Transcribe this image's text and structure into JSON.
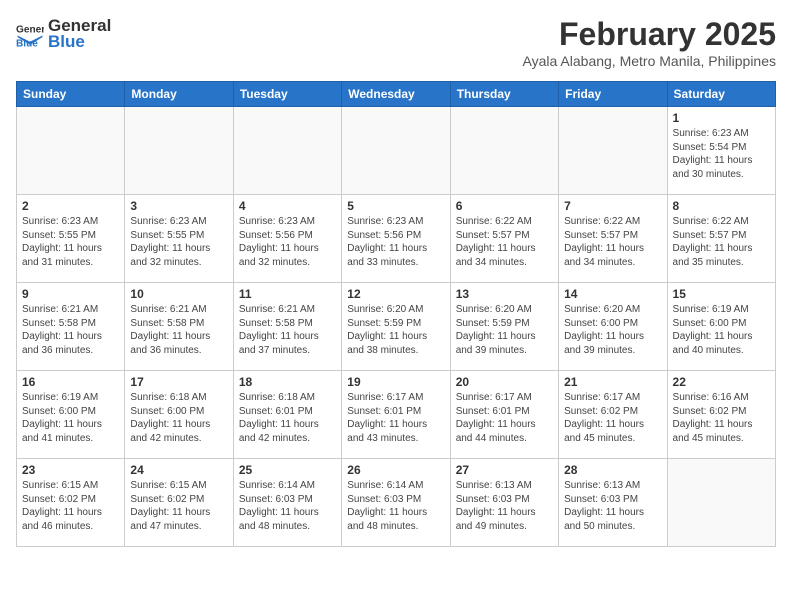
{
  "header": {
    "logo_general": "General",
    "logo_blue": "Blue",
    "month_year": "February 2025",
    "location": "Ayala Alabang, Metro Manila, Philippines"
  },
  "weekdays": [
    "Sunday",
    "Monday",
    "Tuesday",
    "Wednesday",
    "Thursday",
    "Friday",
    "Saturday"
  ],
  "weeks": [
    [
      {
        "day": "",
        "info": ""
      },
      {
        "day": "",
        "info": ""
      },
      {
        "day": "",
        "info": ""
      },
      {
        "day": "",
        "info": ""
      },
      {
        "day": "",
        "info": ""
      },
      {
        "day": "",
        "info": ""
      },
      {
        "day": "1",
        "info": "Sunrise: 6:23 AM\nSunset: 5:54 PM\nDaylight: 11 hours\nand 30 minutes."
      }
    ],
    [
      {
        "day": "2",
        "info": "Sunrise: 6:23 AM\nSunset: 5:55 PM\nDaylight: 11 hours\nand 31 minutes."
      },
      {
        "day": "3",
        "info": "Sunrise: 6:23 AM\nSunset: 5:55 PM\nDaylight: 11 hours\nand 32 minutes."
      },
      {
        "day": "4",
        "info": "Sunrise: 6:23 AM\nSunset: 5:56 PM\nDaylight: 11 hours\nand 32 minutes."
      },
      {
        "day": "5",
        "info": "Sunrise: 6:23 AM\nSunset: 5:56 PM\nDaylight: 11 hours\nand 33 minutes."
      },
      {
        "day": "6",
        "info": "Sunrise: 6:22 AM\nSunset: 5:57 PM\nDaylight: 11 hours\nand 34 minutes."
      },
      {
        "day": "7",
        "info": "Sunrise: 6:22 AM\nSunset: 5:57 PM\nDaylight: 11 hours\nand 34 minutes."
      },
      {
        "day": "8",
        "info": "Sunrise: 6:22 AM\nSunset: 5:57 PM\nDaylight: 11 hours\nand 35 minutes."
      }
    ],
    [
      {
        "day": "9",
        "info": "Sunrise: 6:21 AM\nSunset: 5:58 PM\nDaylight: 11 hours\nand 36 minutes."
      },
      {
        "day": "10",
        "info": "Sunrise: 6:21 AM\nSunset: 5:58 PM\nDaylight: 11 hours\nand 36 minutes."
      },
      {
        "day": "11",
        "info": "Sunrise: 6:21 AM\nSunset: 5:58 PM\nDaylight: 11 hours\nand 37 minutes."
      },
      {
        "day": "12",
        "info": "Sunrise: 6:20 AM\nSunset: 5:59 PM\nDaylight: 11 hours\nand 38 minutes."
      },
      {
        "day": "13",
        "info": "Sunrise: 6:20 AM\nSunset: 5:59 PM\nDaylight: 11 hours\nand 39 minutes."
      },
      {
        "day": "14",
        "info": "Sunrise: 6:20 AM\nSunset: 6:00 PM\nDaylight: 11 hours\nand 39 minutes."
      },
      {
        "day": "15",
        "info": "Sunrise: 6:19 AM\nSunset: 6:00 PM\nDaylight: 11 hours\nand 40 minutes."
      }
    ],
    [
      {
        "day": "16",
        "info": "Sunrise: 6:19 AM\nSunset: 6:00 PM\nDaylight: 11 hours\nand 41 minutes."
      },
      {
        "day": "17",
        "info": "Sunrise: 6:18 AM\nSunset: 6:00 PM\nDaylight: 11 hours\nand 42 minutes."
      },
      {
        "day": "18",
        "info": "Sunrise: 6:18 AM\nSunset: 6:01 PM\nDaylight: 11 hours\nand 42 minutes."
      },
      {
        "day": "19",
        "info": "Sunrise: 6:17 AM\nSunset: 6:01 PM\nDaylight: 11 hours\nand 43 minutes."
      },
      {
        "day": "20",
        "info": "Sunrise: 6:17 AM\nSunset: 6:01 PM\nDaylight: 11 hours\nand 44 minutes."
      },
      {
        "day": "21",
        "info": "Sunrise: 6:17 AM\nSunset: 6:02 PM\nDaylight: 11 hours\nand 45 minutes."
      },
      {
        "day": "22",
        "info": "Sunrise: 6:16 AM\nSunset: 6:02 PM\nDaylight: 11 hours\nand 45 minutes."
      }
    ],
    [
      {
        "day": "23",
        "info": "Sunrise: 6:15 AM\nSunset: 6:02 PM\nDaylight: 11 hours\nand 46 minutes."
      },
      {
        "day": "24",
        "info": "Sunrise: 6:15 AM\nSunset: 6:02 PM\nDaylight: 11 hours\nand 47 minutes."
      },
      {
        "day": "25",
        "info": "Sunrise: 6:14 AM\nSunset: 6:03 PM\nDaylight: 11 hours\nand 48 minutes."
      },
      {
        "day": "26",
        "info": "Sunrise: 6:14 AM\nSunset: 6:03 PM\nDaylight: 11 hours\nand 48 minutes."
      },
      {
        "day": "27",
        "info": "Sunrise: 6:13 AM\nSunset: 6:03 PM\nDaylight: 11 hours\nand 49 minutes."
      },
      {
        "day": "28",
        "info": "Sunrise: 6:13 AM\nSunset: 6:03 PM\nDaylight: 11 hours\nand 50 minutes."
      },
      {
        "day": "",
        "info": ""
      }
    ]
  ]
}
